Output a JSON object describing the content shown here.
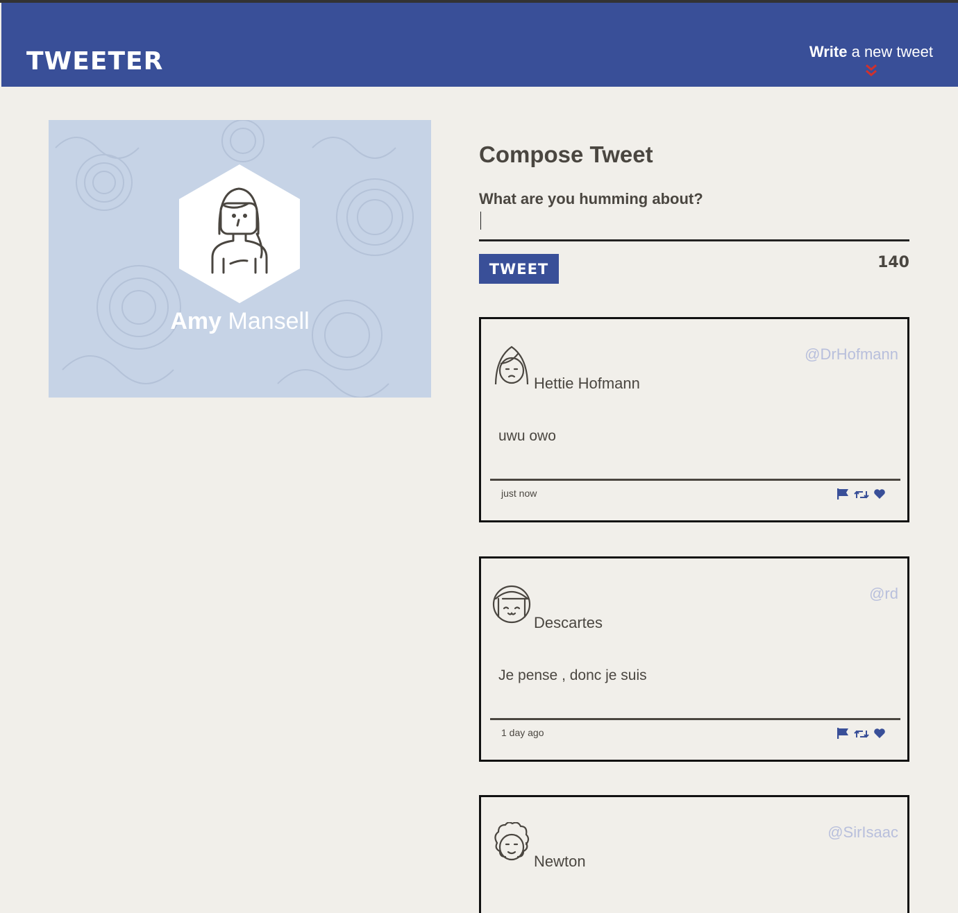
{
  "nav": {
    "brand": "TWEETER",
    "write_bold": "Write",
    "write_rest": " a new tweet"
  },
  "profile": {
    "first_name": "Amy",
    "last_name": " Mansell"
  },
  "compose": {
    "title": "Compose Tweet",
    "label": "What are you humming about?",
    "input_value": "",
    "button_label": "TWEET",
    "counter": "140"
  },
  "tweets": [
    {
      "name": "Hettie Hofmann",
      "handle": "@DrHofmann",
      "text": "uwu owo",
      "time": "just now"
    },
    {
      "name": "Descartes",
      "handle": "@rd",
      "text": "Je pense , donc je suis",
      "time": "1 day ago"
    },
    {
      "name": "Newton",
      "handle": "@SirIsaac",
      "text": "",
      "time": ""
    }
  ],
  "colors": {
    "nav": "#394f98",
    "background": "#f1efea",
    "accent_red": "#d0312d",
    "handle": "#b8bfdc"
  }
}
